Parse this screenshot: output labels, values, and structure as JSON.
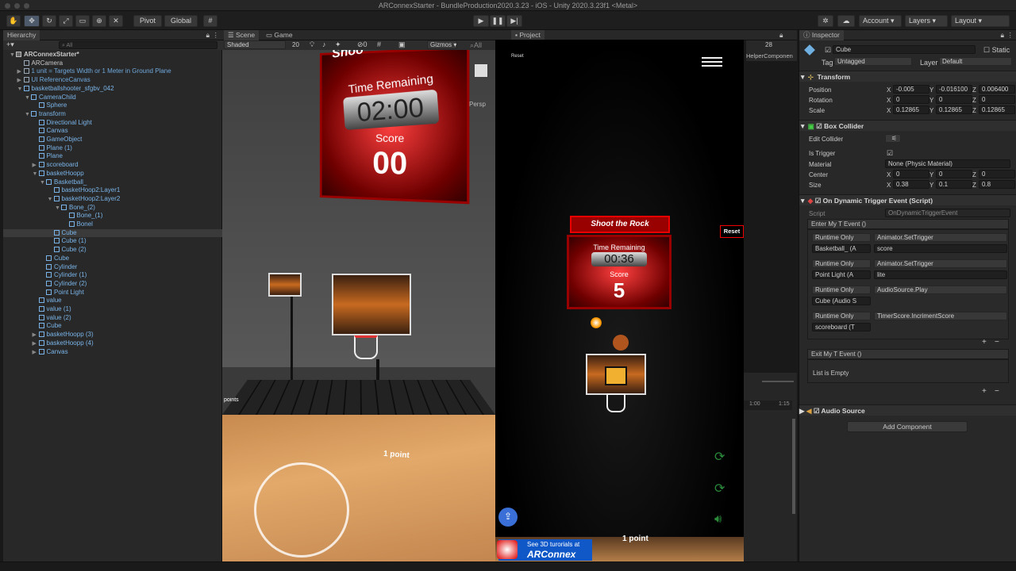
{
  "title": "ARConnexStarter - BundleProduction2020.3.23 - iOS - Unity 2020.3.23f1 <Metal>",
  "toolbar": {
    "pivot": "Pivot",
    "global": "Global",
    "account": "Account",
    "layers": "Layers",
    "layout": "Layout"
  },
  "hierarchy": {
    "tab": "Hierarchy",
    "search_placeholder": "All",
    "rows": [
      {
        "label": "ARConnexStarter*",
        "indent": 0,
        "arrow": "▼",
        "kind": "scene"
      },
      {
        "label": "ARCamera",
        "indent": 1,
        "arrow": "",
        "kind": "obj"
      },
      {
        "label": "1 unit = Targets Width or 1 Meter in Ground Plane",
        "indent": 1,
        "arrow": "▶",
        "kind": "blue"
      },
      {
        "label": "UI ReferenceCanvas",
        "indent": 1,
        "arrow": "▶",
        "kind": "blue"
      },
      {
        "label": "basketballshooter_sfgbv_042",
        "indent": 1,
        "arrow": "▼",
        "kind": "prefab"
      },
      {
        "label": "CameraChild",
        "indent": 2,
        "arrow": "▼",
        "kind": "prefab"
      },
      {
        "label": "Sphere",
        "indent": 3,
        "arrow": "",
        "kind": "prefab"
      },
      {
        "label": "transform",
        "indent": 2,
        "arrow": "▼",
        "kind": "prefab"
      },
      {
        "label": "Directional Light",
        "indent": 3,
        "arrow": "",
        "kind": "prefab"
      },
      {
        "label": "Canvas",
        "indent": 3,
        "arrow": "",
        "kind": "prefab"
      },
      {
        "label": "GameObject",
        "indent": 3,
        "arrow": "",
        "kind": "prefab"
      },
      {
        "label": "Plane (1)",
        "indent": 3,
        "arrow": "",
        "kind": "prefab"
      },
      {
        "label": "Plane",
        "indent": 3,
        "arrow": "",
        "kind": "prefab"
      },
      {
        "label": "scoreboard",
        "indent": 3,
        "arrow": "▶",
        "kind": "prefab"
      },
      {
        "label": "basketHoopp",
        "indent": 3,
        "arrow": "▼",
        "kind": "prefab"
      },
      {
        "label": "Basketball_",
        "indent": 4,
        "arrow": "▼",
        "kind": "prefab"
      },
      {
        "label": "basketHoop2:Layer1",
        "indent": 5,
        "arrow": "",
        "kind": "prefab"
      },
      {
        "label": "basketHoop2:Layer2",
        "indent": 5,
        "arrow": "▼",
        "kind": "prefab"
      },
      {
        "label": "Bone_(2)",
        "indent": 6,
        "arrow": "▼",
        "kind": "prefab"
      },
      {
        "label": "Bone_(1)",
        "indent": 7,
        "arrow": "",
        "kind": "prefab"
      },
      {
        "label": "Bonel",
        "indent": 7,
        "arrow": "",
        "kind": "prefab"
      },
      {
        "label": "Cube",
        "indent": 5,
        "arrow": "",
        "kind": "prefab",
        "selected": true
      },
      {
        "label": "Cube (1)",
        "indent": 5,
        "arrow": "",
        "kind": "prefab"
      },
      {
        "label": "Cube (2)",
        "indent": 5,
        "arrow": "",
        "kind": "prefab"
      },
      {
        "label": "Cube",
        "indent": 4,
        "arrow": "",
        "kind": "prefab"
      },
      {
        "label": "Cylinder",
        "indent": 4,
        "arrow": "",
        "kind": "prefab"
      },
      {
        "label": "Cylinder (1)",
        "indent": 4,
        "arrow": "",
        "kind": "prefab"
      },
      {
        "label": "Cylinder (2)",
        "indent": 4,
        "arrow": "",
        "kind": "prefab"
      },
      {
        "label": "Point Light",
        "indent": 4,
        "arrow": "",
        "kind": "prefab"
      },
      {
        "label": "value",
        "indent": 3,
        "arrow": "",
        "kind": "prefab"
      },
      {
        "label": "value (1)",
        "indent": 3,
        "arrow": "",
        "kind": "prefab"
      },
      {
        "label": "value (2)",
        "indent": 3,
        "arrow": "",
        "kind": "prefab"
      },
      {
        "label": "Cube",
        "indent": 3,
        "arrow": "",
        "kind": "prefab"
      },
      {
        "label": "basketHoopp (3)",
        "indent": 3,
        "arrow": "▶",
        "kind": "prefab"
      },
      {
        "label": "basketHoopp (4)",
        "indent": 3,
        "arrow": "▶",
        "kind": "prefab"
      },
      {
        "label": "Canvas",
        "indent": 3,
        "arrow": "▶",
        "kind": "prefab"
      }
    ]
  },
  "scene": {
    "tab_scene": "Scene",
    "tab_game": "Game",
    "shading": "Shaded",
    "gizmos": "Gizmos",
    "all": "All",
    "twenty": "20",
    "persp": "Persp",
    "time_remaining": "Time Remaining",
    "timer": "02:00",
    "score_label": "Score",
    "score": "00",
    "points_label": "points",
    "one_point": "1 point",
    "shoot": "Shoo"
  },
  "project": {
    "tab": "Project",
    "helper": "HelperComponen",
    "t100": "1:00",
    "t115": "1:15",
    "count": "28"
  },
  "game": {
    "reset_small": "Reset",
    "title": "Shoot the Rock",
    "time_remaining": "Time Remaining",
    "timer": "00:36",
    "score_label": "Score",
    "score": "5",
    "reset_button": "Reset",
    "banner_line1": "See 3D turorials at",
    "banner_brand": "ARConnex",
    "one_point": "1 point"
  },
  "inspector": {
    "tab": "Inspector",
    "object_name": "Cube",
    "static": "Static",
    "tag_label": "Tag",
    "tag": "Untagged",
    "layer_label": "Layer",
    "layer": "Default",
    "transform": {
      "title": "Transform",
      "position_label": "Position",
      "px": "-0.005",
      "py": "-0.016100",
      "pz": "0.006400",
      "rotation_label": "Rotation",
      "rx": "0",
      "ry": "0",
      "rz": "0",
      "scale_label": "Scale",
      "sx": "0.12865",
      "sy": "0.12865",
      "sz": "0.12865"
    },
    "box": {
      "title": "Box Collider",
      "edit": "Edit Collider",
      "trigger": "Is Trigger",
      "material_label": "Material",
      "material": "None (Physic Material)",
      "center_label": "Center",
      "cx": "0",
      "cy": "0",
      "cz": "0",
      "size_label": "Size",
      "szx": "0.38",
      "szy": "0.1",
      "szz": "0.8"
    },
    "event": {
      "title": "On Dynamic Trigger Event (Script)",
      "script_label": "Script",
      "script": "OnDynamicTriggerEvent",
      "enter": "Enter My T Event ()",
      "exit": "Exit My T Event ()",
      "empty": "List is Empty",
      "entries": [
        {
          "mode": "Runtime Only",
          "func": "Animator.SetTrigger",
          "obj": "Basketball_ (A",
          "arg": "score"
        },
        {
          "mode": "Runtime Only",
          "func": "Animator.SetTrigger",
          "obj": "Point Light (A",
          "arg": "lite"
        },
        {
          "mode": "Runtime Only",
          "func": "AudioSource.Play",
          "obj": "Cube (Audio S",
          "arg": ""
        },
        {
          "mode": "Runtime Only",
          "func": "TimerScore.IncrimentScore",
          "obj": "scoreboard (T",
          "arg": ""
        }
      ]
    },
    "audio": "Audio Source",
    "add_component": "Add Component"
  },
  "axis": {
    "x": "X",
    "y": "Y",
    "z": "Z"
  },
  "colors": {
    "accent": "#4d78cc",
    "selected": "#3a3a3a",
    "red": "#d01010"
  }
}
